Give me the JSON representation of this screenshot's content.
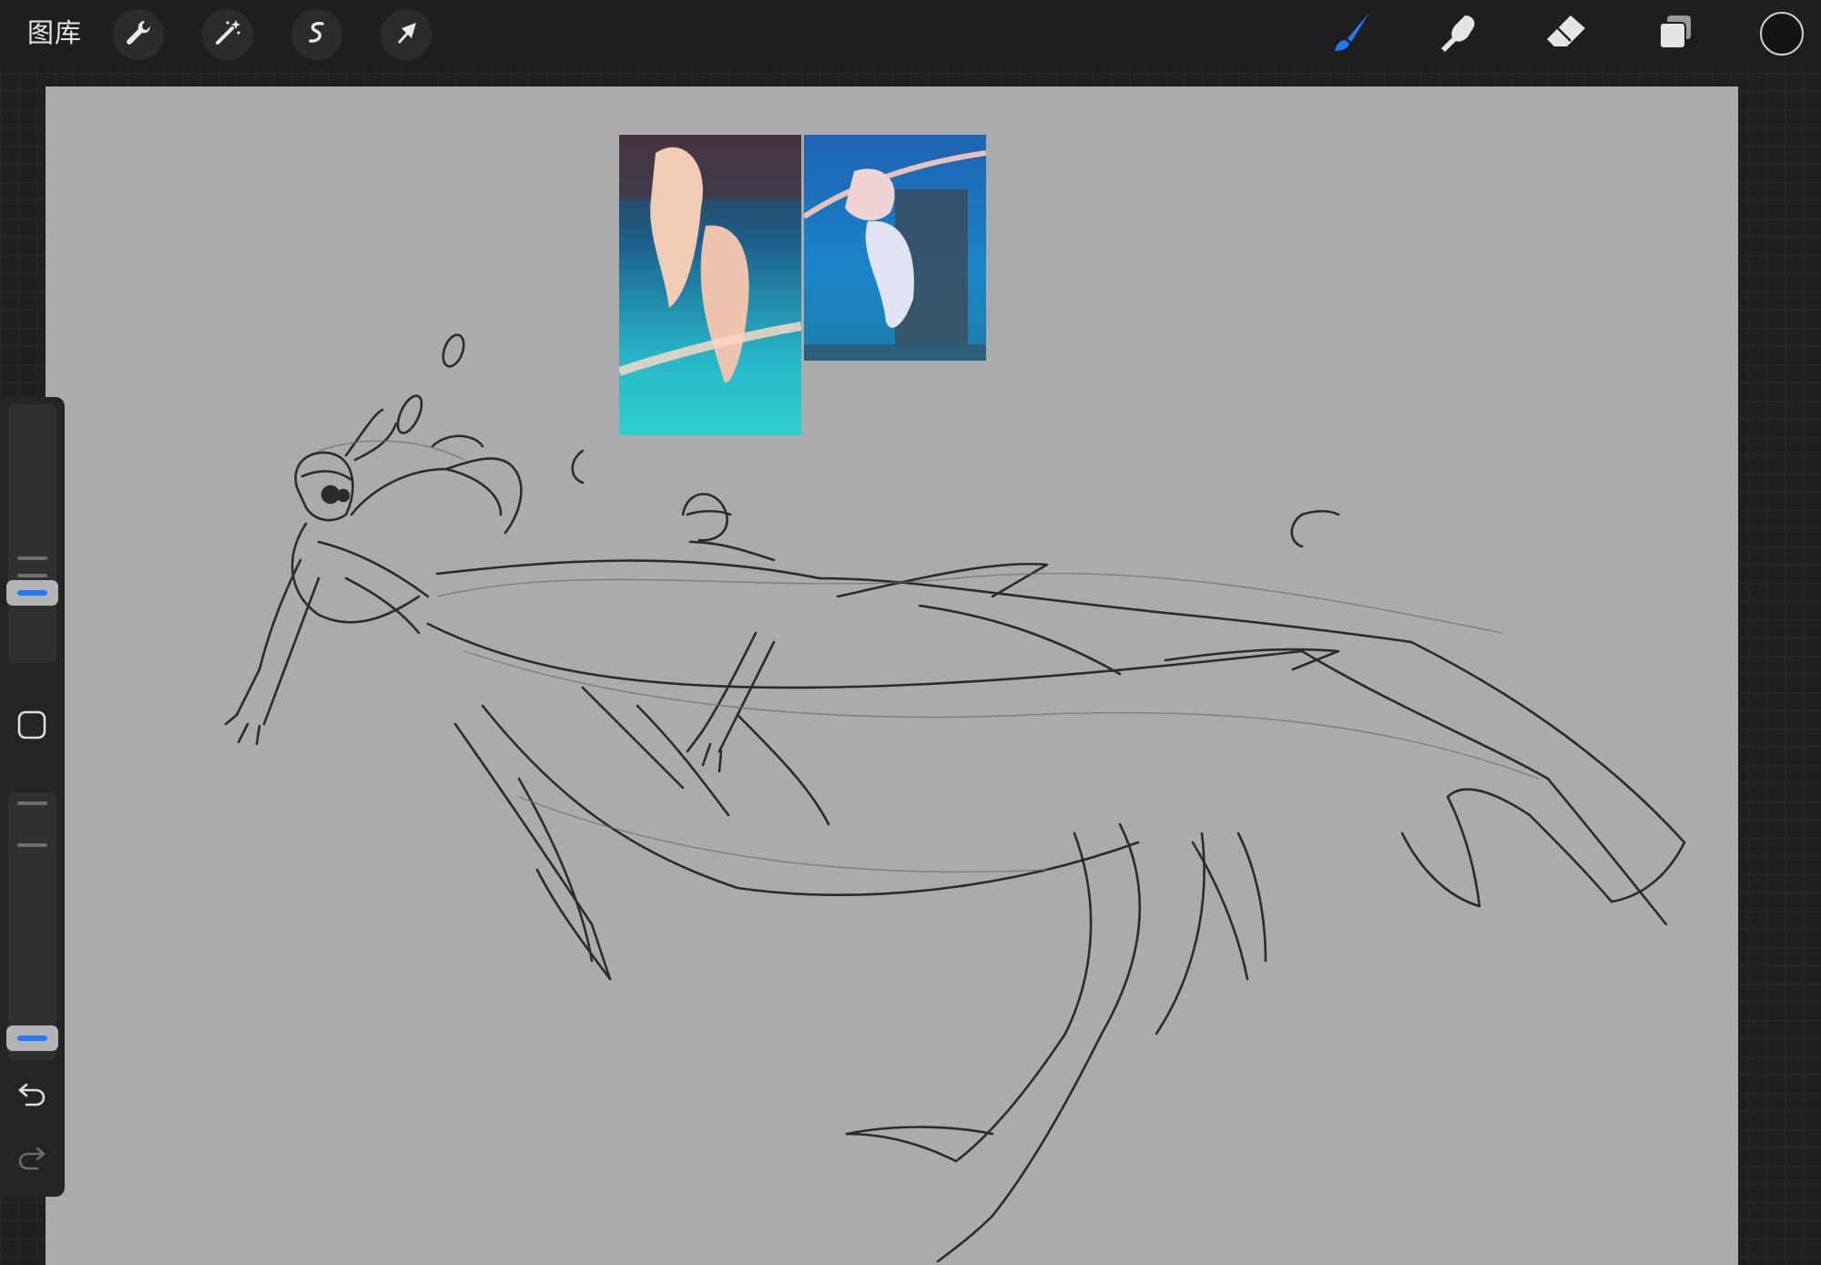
{
  "app": {
    "gallery_label": "图库"
  },
  "toolbar": {
    "left_tools": [
      {
        "name": "actions",
        "icon": "wrench-icon"
      },
      {
        "name": "adjustments",
        "icon": "magic-wand-icon"
      },
      {
        "name": "selection",
        "icon": "selection-s-icon"
      },
      {
        "name": "transform",
        "icon": "arrow-cursor-icon"
      }
    ],
    "right_tools": [
      {
        "name": "brush",
        "icon": "brush-icon",
        "active": true
      },
      {
        "name": "smudge",
        "icon": "smudge-finger-icon",
        "active": false
      },
      {
        "name": "eraser",
        "icon": "eraser-icon",
        "active": false
      },
      {
        "name": "layers",
        "icon": "layers-icon",
        "active": false
      }
    ],
    "current_color": "#141414"
  },
  "sidebar": {
    "brush_size_level": 0.27,
    "opacity_level": 0.0,
    "icons": [
      "modify-square-icon",
      "undo-icon",
      "redo-icon"
    ]
  },
  "colors": {
    "accent": "#1e7bf5",
    "canvas": "#ababab",
    "background": "#1f1f21"
  }
}
